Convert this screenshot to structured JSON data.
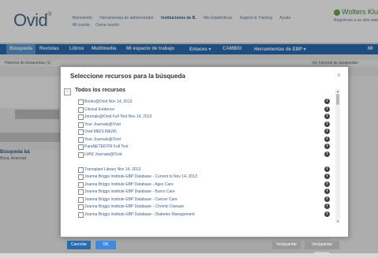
{
  "header": {
    "logo": "Ovid",
    "logo_mark": "®",
    "links": [
      "Bienvenido",
      "Herramientas de administrador",
      "Instituciones de B.",
      "Mis Estadísticas",
      "Support & Training",
      "Ayuda"
    ],
    "links2": [
      "Mi cuenta",
      "Cerrar sesión"
    ],
    "brand": "Wolters Klu",
    "brand_sub": "Regístrese a un sitio web"
  },
  "nav": {
    "items": [
      "Búsqueda",
      "Revistas",
      "Libros",
      "Multimedia",
      "Mi espacio de trabajo",
      "Enlaces ▾",
      "CAMBIO",
      "Herramientas de EBP ▾",
      "Mi"
    ]
  },
  "background": {
    "history_label": "Historial de búsquedas (1)",
    "options": "Ver historial de búsquedas",
    "search_title": "Búsqueda bá",
    "search_sub": "Búsq. Avanzad"
  },
  "modal": {
    "title": "Seleccione recursos para la búsqueda",
    "close": "×",
    "root_label": "Todos los recursos",
    "root_toggle": "-",
    "resources": [
      "Books@Ovid Nov 14, 2013",
      "Clinical Evidence",
      "Journals@Ovid Full Text Nov 14, 2013",
      "Your Journals@Ovid",
      "Ovid MEDLINE(R)",
      "Your Journals@Ovid",
      "ParaNETEDITR Full Text",
      "LWW Journals@Ovid",
      "",
      "Transplant Library Nov 14, 2013",
      "Joanna Briggs Institute EBP Database - Current to Nov 14, 2013",
      "Joanna Briggs Institute EBP Database - Ages Care",
      "Joanna Briggs Institute EBP Database - Burns Care",
      "Joanna Briggs Institute EBP Database - Cancer Care",
      "Joanna Briggs Institute EBP Database - Chronic Disease",
      "Joanna Briggs Institute EBP Database - Diabetes Management"
    ],
    "info_symbol": "i",
    "buttons": {
      "cancel": "Cancelar",
      "ok": "OK",
      "group1": "Ver/guardar",
      "group2": "Ver/guardar recursos"
    }
  }
}
